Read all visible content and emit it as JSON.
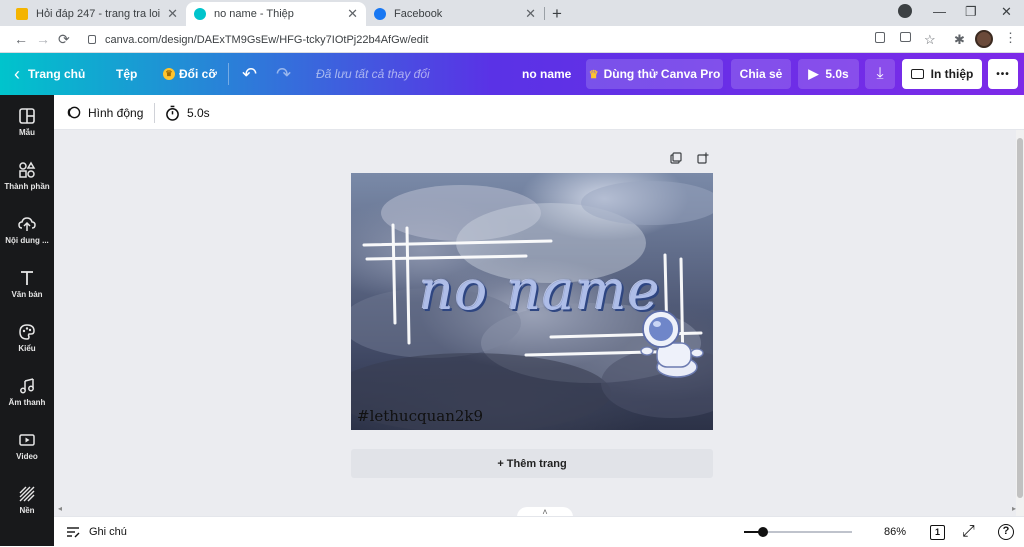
{
  "browser": {
    "tabs": [
      {
        "title": "Hỏi đáp 247 - trang tra loi",
        "active": false
      },
      {
        "title": "no name - Thiệp",
        "active": true
      },
      {
        "title": "Facebook",
        "active": false
      }
    ],
    "new_tab_glyph": "+",
    "tab_close_glyph": "✕",
    "window_controls": {
      "minimize": "—",
      "restore": "❐",
      "close": "✕"
    },
    "address_bar": {
      "url": "canva.com/design/DAExTM9GsEw/HFG-tcky7IOtPj22b4AfGw/edit"
    },
    "nav": {
      "back": "←",
      "forward": "→",
      "reload": "⟳"
    }
  },
  "editor_topbar": {
    "home_label": "Trang chủ",
    "back_glyph": "‹",
    "file_label": "Tệp",
    "resize_label": "Đổi cỡ",
    "undo_glyph": "↶",
    "redo_glyph": "↷",
    "save_status": "Đã lưu tất cả thay đổi",
    "design_name": "no name",
    "try_pro_label": "Dùng thử Canva Pro",
    "share_label": "Chia sẻ",
    "play_duration": "5.0s",
    "download_glyph": "⤓",
    "print_label": "In thiệp",
    "more_glyph": "•••",
    "accent_gradient": [
      "#00c4cc",
      "#5a32e6",
      "#7d2ae8"
    ]
  },
  "sidebar": {
    "items": [
      {
        "label": "Mẫu",
        "icon": "template-icon"
      },
      {
        "label": "Thành phần",
        "icon": "elements-icon"
      },
      {
        "label": "Nội dung ...",
        "icon": "upload-icon"
      },
      {
        "label": "Văn bản",
        "icon": "text-icon"
      },
      {
        "label": "Kiểu",
        "icon": "palette-icon"
      },
      {
        "label": "Âm thanh",
        "icon": "music-icon"
      },
      {
        "label": "Video",
        "icon": "video-icon"
      },
      {
        "label": "Nền",
        "icon": "background-icon"
      }
    ]
  },
  "subtoolbar": {
    "animate_label": "Hình động",
    "duration_label": "5.0s"
  },
  "canvas": {
    "design_title": "no name",
    "hashtag": "#lethucquan2k9",
    "add_page_label": "+ Thêm trang",
    "collapse_glyph": "˄"
  },
  "bottombar": {
    "notes_label": "Ghi chú",
    "zoom_percent": "86%",
    "zoom_fraction": 0.18,
    "page_count": "1",
    "fullscreen_glyph": "⤢",
    "help_glyph": "?"
  }
}
